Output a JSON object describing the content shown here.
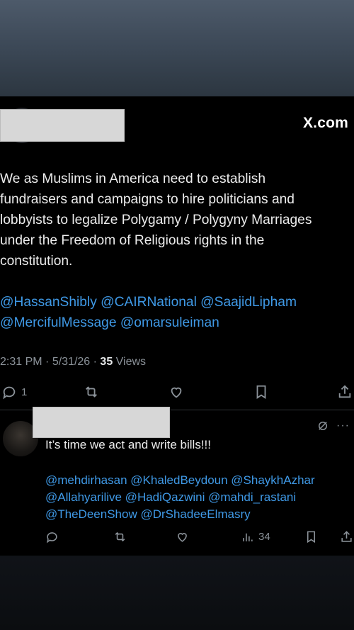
{
  "brand": {
    "label": "X.com"
  },
  "tweet": {
    "text": "We as Muslims in America need to establish\nfundraisers and campaigns to hire politicians and\nlobbyists to legalize Polygamy / Polygyny Marriages\nunder the Freedom of Religious rights in the\nconstitution.",
    "mentions": [
      "@HassanShibly @CAIRNational @SaajidLipham",
      "@MercifulMessage @omarsuleiman"
    ],
    "time": "2:31 PM",
    "separator1": " · ",
    "date": "5/31/26",
    "separator2": " · ",
    "views_count": "35",
    "views_label": " Views",
    "reply_count": "1"
  },
  "reply": {
    "text": "It’s time we act and write bills!!!",
    "mentions": [
      "@mehdirhasan @KhaledBeydoun @ShaykhAzhar",
      "@Allahyarilive @HadiQazwini @mahdi_rastani",
      "@TheDeenShow @DrShadeeElmasry"
    ],
    "views_count": "34",
    "more_label": "···"
  },
  "colors": {
    "background": "#000000",
    "text": "#e7e9ea",
    "muted": "#8b9299",
    "link": "#3f99e6",
    "redaction": "#d7d7d7"
  },
  "icons": [
    "reply-icon",
    "retweet-icon",
    "like-icon",
    "bookmark-icon",
    "share-icon",
    "grok-icon",
    "views-icon"
  ]
}
